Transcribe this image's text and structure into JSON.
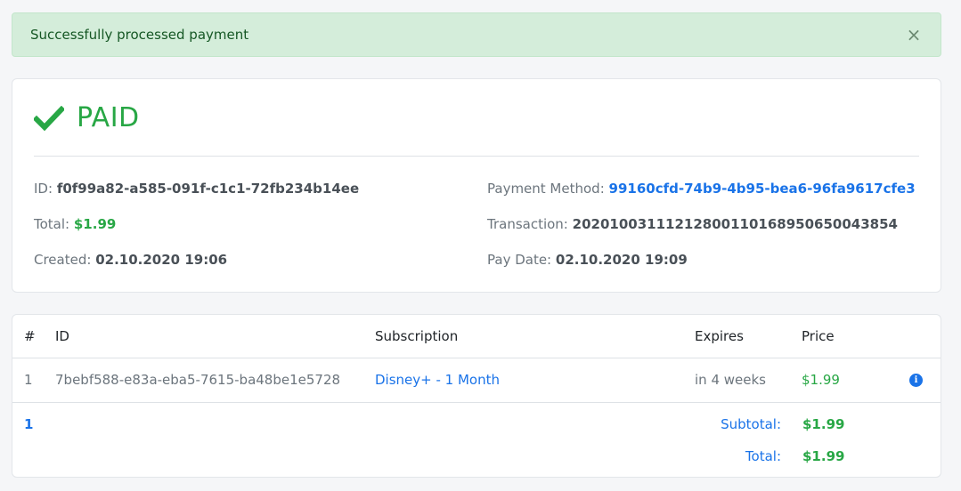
{
  "alert": {
    "message": "Successfully processed payment",
    "close": "×"
  },
  "payment": {
    "status": "PAID",
    "id_label": "ID:",
    "id": "f0f99a82-a585-091f-c1c1-72fb234b14ee",
    "total_label": "Total:",
    "total": "$1.99",
    "created_label": "Created:",
    "created": "02.10.2020 19:06",
    "method_label": "Payment Method:",
    "method": "99160cfd-74b9-4b95-bea6-96fa9617cfe3",
    "transaction_label": "Transaction:",
    "transaction": "20201003111212800110168950650043854",
    "paydate_label": "Pay Date:",
    "paydate": "02.10.2020 19:09"
  },
  "table": {
    "headers": {
      "num": "#",
      "id": "ID",
      "subscription": "Subscription",
      "expires": "Expires",
      "price": "Price"
    },
    "rows": [
      {
        "num": "1",
        "id": "7bebf588-e83a-eba5-7615-ba48be1e5728",
        "subscription": "Disney+ - 1 Month",
        "expires": "in 4 weeks",
        "price": "$1.99"
      }
    ],
    "footer": {
      "count": "1",
      "subtotal_label": "Subtotal:",
      "subtotal": "$1.99",
      "total_label": "Total:",
      "total": "$1.99"
    }
  },
  "colors": {
    "success": "#28a745",
    "link": "#1a73e8",
    "alert_bg": "#d4edda"
  }
}
